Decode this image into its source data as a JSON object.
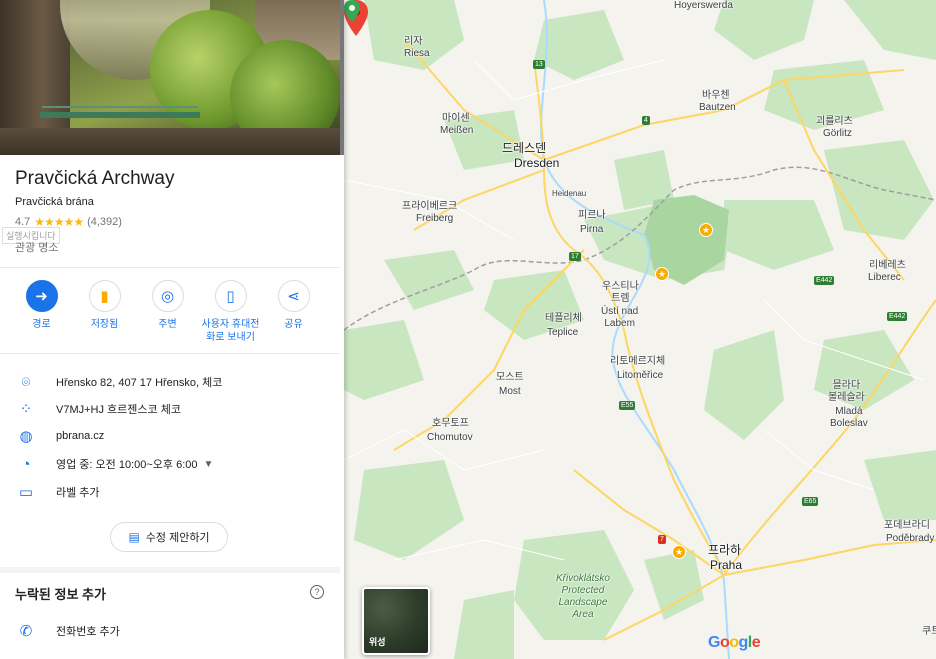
{
  "place": {
    "title": "Pravčická Archway",
    "subtitle": "Pravčická brána",
    "rating": "4.7",
    "stars": "★★★★★",
    "reviews": "(4,392)",
    "tooltip": "실행시킵니다",
    "category": "관광 명소"
  },
  "actions": [
    {
      "label": "경로",
      "icon": "directions-icon",
      "glyph": "➜"
    },
    {
      "label": "저장됨",
      "icon": "bookmark-icon",
      "glyph": "🔖"
    },
    {
      "label": "주변",
      "icon": "nearby-icon",
      "glyph": "◎"
    },
    {
      "label": "사용자 휴대전화로 보내기",
      "icon": "send-to-phone-icon",
      "glyph": "▯"
    },
    {
      "label": "공유",
      "icon": "share-icon",
      "glyph": "⋖"
    }
  ],
  "info": {
    "address": "Hřensko 82, 407 17 Hřensko, 체코",
    "pluscode": "V7MJ+HJ 흐르젠스코 체코",
    "website": "pbrana.cz",
    "hours": "영업 중:  오전 10:00~오후 6:00",
    "label": "라벨 추가"
  },
  "suggest_edit": "수정 제안하기",
  "missing_info": {
    "title": "누락된 정보 추가",
    "help": "?",
    "phone": "전화번호 추가"
  },
  "map": {
    "cities": {
      "hoyerswerda": "Hoyerswerda",
      "riesa_ko": "리자",
      "riesa": "Riesa",
      "bautzen_ko": "바우첸",
      "bautzen": "Bautzen",
      "meissen_ko": "마이센",
      "meissen": "Meißen",
      "goerlitz_ko": "괴를리츠",
      "goerlitz": "Görlitz",
      "dresden_ko": "드레스덴",
      "dresden": "Dresden",
      "heidenau": "Heidenau",
      "freiberg_ko": "프라이베르크",
      "freiberg": "Freiberg",
      "pirna_ko": "피르나",
      "pirna": "Pirna",
      "liberec_ko": "리베레츠",
      "liberec": "Liberec",
      "usti_ko": "우스티나\n트렘",
      "usti": "Ústí nad\nLabem",
      "teplice_ko": "테플리체",
      "teplice": "Teplice",
      "litomerice_ko": "리토메르지체",
      "litomerice": "Litoměřice",
      "most_ko": "모스트",
      "most": "Most",
      "mlada_ko": "믈라다\n볼레슬라",
      "mlada": "Mladá\nBoleslav",
      "chomutov_ko": "호무토프",
      "chomutov": "Chomutov",
      "podebrady_ko": "포데브라디",
      "podebrady": "Poděbrady",
      "praha_ko": "프라하",
      "praha": "Praha",
      "krivoklat": "Křivoklátsko\nProtected\nLandscape\nArea",
      "kut": "쿠트"
    },
    "shields": {
      "r13": "13",
      "r4": "4",
      "r17": "17",
      "r7": "7",
      "e442a": "E442",
      "e442b": "E442",
      "e55": "E55",
      "e65": "E65"
    },
    "satellite_label": "위성",
    "logo": "Google"
  }
}
